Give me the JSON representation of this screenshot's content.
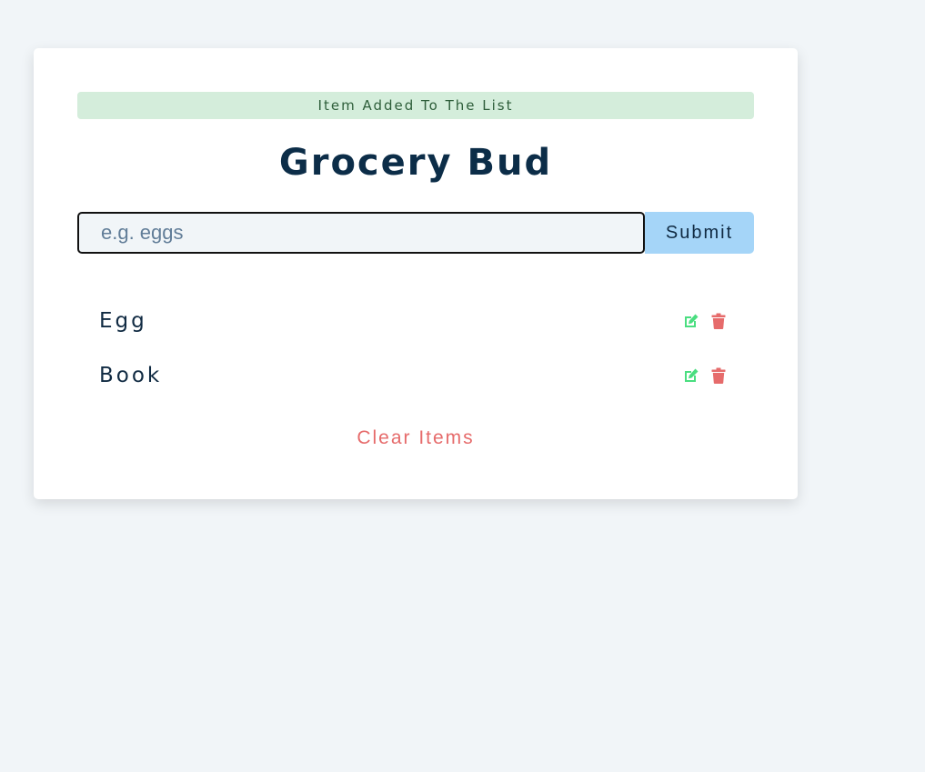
{
  "alert": {
    "text": "Item Added To The List",
    "color": "#d4eddb"
  },
  "header": {
    "title": "Grocery Bud"
  },
  "form": {
    "input_value": "",
    "placeholder": "e.g. eggs",
    "submit_label": "Submit"
  },
  "items": [
    {
      "title": "Egg",
      "edit_icon": "edit-icon",
      "delete_icon": "trash-icon"
    },
    {
      "title": "Book",
      "edit_icon": "edit-icon",
      "delete_icon": "trash-icon"
    }
  ],
  "footer": {
    "clear_label": "Clear Items"
  },
  "colors": {
    "edit": "#4ade80",
    "delete": "#e66b6b",
    "submit": "#a5d5f8",
    "title": "#0c2d48"
  }
}
